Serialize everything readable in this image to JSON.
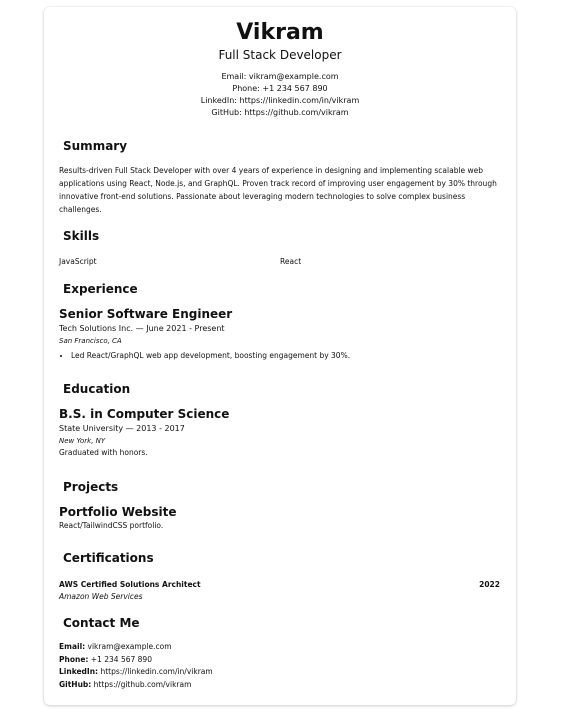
{
  "header": {
    "name": "Vikram",
    "title": "Full Stack Developer",
    "email": "Email: vikram@example.com",
    "phone": "Phone: +1 234 567 890",
    "linkedin": "LinkedIn: https://linkedin.com/in/vikram",
    "github": "GitHub: https://github.com/vikram"
  },
  "sections": {
    "summary": {
      "title": "Summary",
      "text": "Results-driven Full Stack Developer with over 4 years of experience in designing and implementing scalable web applications using React, Node.js, and GraphQL. Proven track record of improving user engagement by 30% through innovative front-end solutions. Passionate about leveraging modern technologies to solve complex business challenges."
    },
    "skills": {
      "title": "Skills",
      "items": [
        "JavaScript",
        "React"
      ]
    },
    "experience": {
      "title": "Experience",
      "job_title": "Senior Software Engineer",
      "company_line": "Tech Solutions Inc. — June 2021 - Present",
      "location": "San Francisco, CA",
      "bullets": [
        "Led React/GraphQL web app development, boosting engagement by 30%."
      ]
    },
    "education": {
      "title": "Education",
      "degree": "B.S. in Computer Science",
      "school_line": "State University — 2013 - 2017",
      "location": "New York, NY",
      "note": "Graduated with honors."
    },
    "projects": {
      "title": "Projects",
      "name": "Portfolio Website",
      "description": "React/TailwindCSS portfolio."
    },
    "certifications": {
      "title": "Certifications",
      "name": "AWS Certified Solutions Architect",
      "year": "2022",
      "issuer": "Amazon Web Services"
    },
    "contact_me": {
      "title": "Contact Me",
      "email_label": "Email:",
      "email": " vikram@example.com",
      "phone_label": "Phone:",
      "phone": " +1 234 567 890",
      "linkedin_label": "LinkedIn:",
      "linkedin": " https://linkedin.com/in/vikram",
      "github_label": "GitHub:",
      "github": " https://github.com/vikram"
    }
  }
}
